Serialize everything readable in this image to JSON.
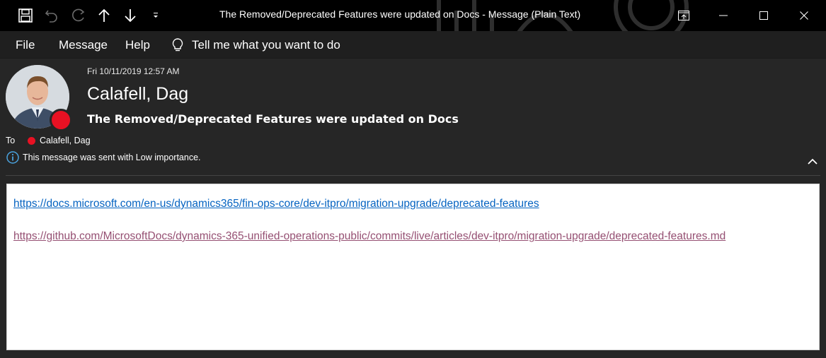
{
  "window": {
    "title": "The Removed/Deprecated Features were updated on Docs  -  Message (Plain Text)"
  },
  "quick_access": {
    "icons": [
      "save-icon",
      "undo-icon",
      "redo-icon",
      "previous-item-icon",
      "next-item-icon",
      "customize-qat-icon"
    ]
  },
  "window_controls": {
    "icons": [
      "ribbon-display-options-icon",
      "minimize-icon",
      "maximize-icon",
      "close-icon"
    ]
  },
  "ribbon": {
    "tabs": [
      "File",
      "Message",
      "Help"
    ],
    "tell_me": "Tell me what you want to do"
  },
  "header": {
    "date": "Fri 10/11/2019 12:57 AM",
    "sender": "Calafell, Dag",
    "subject": "The Removed/Deprecated Features were updated on Docs",
    "to_label": "To",
    "recipient": "Calafell, Dag",
    "importance_notice": "This message was sent with Low importance."
  },
  "body": {
    "link1": "https://docs.microsoft.com/en-us/dynamics365/fin-ops-core/dev-itpro/migration-upgrade/deprecated-features",
    "link2": "https://github.com/MicrosoftDocs/dynamics-365-unified-operations-public/commits/live/articles/dev-itpro/migration-upgrade/deprecated-features.md"
  },
  "colors": {
    "titlebar": "#000000",
    "ribbon": "#1f1f1f",
    "background": "#262626",
    "presence_busy": "#e81123",
    "link": "#0563c1",
    "visited_link": "#954f72",
    "info_icon": "#4aa3df"
  }
}
